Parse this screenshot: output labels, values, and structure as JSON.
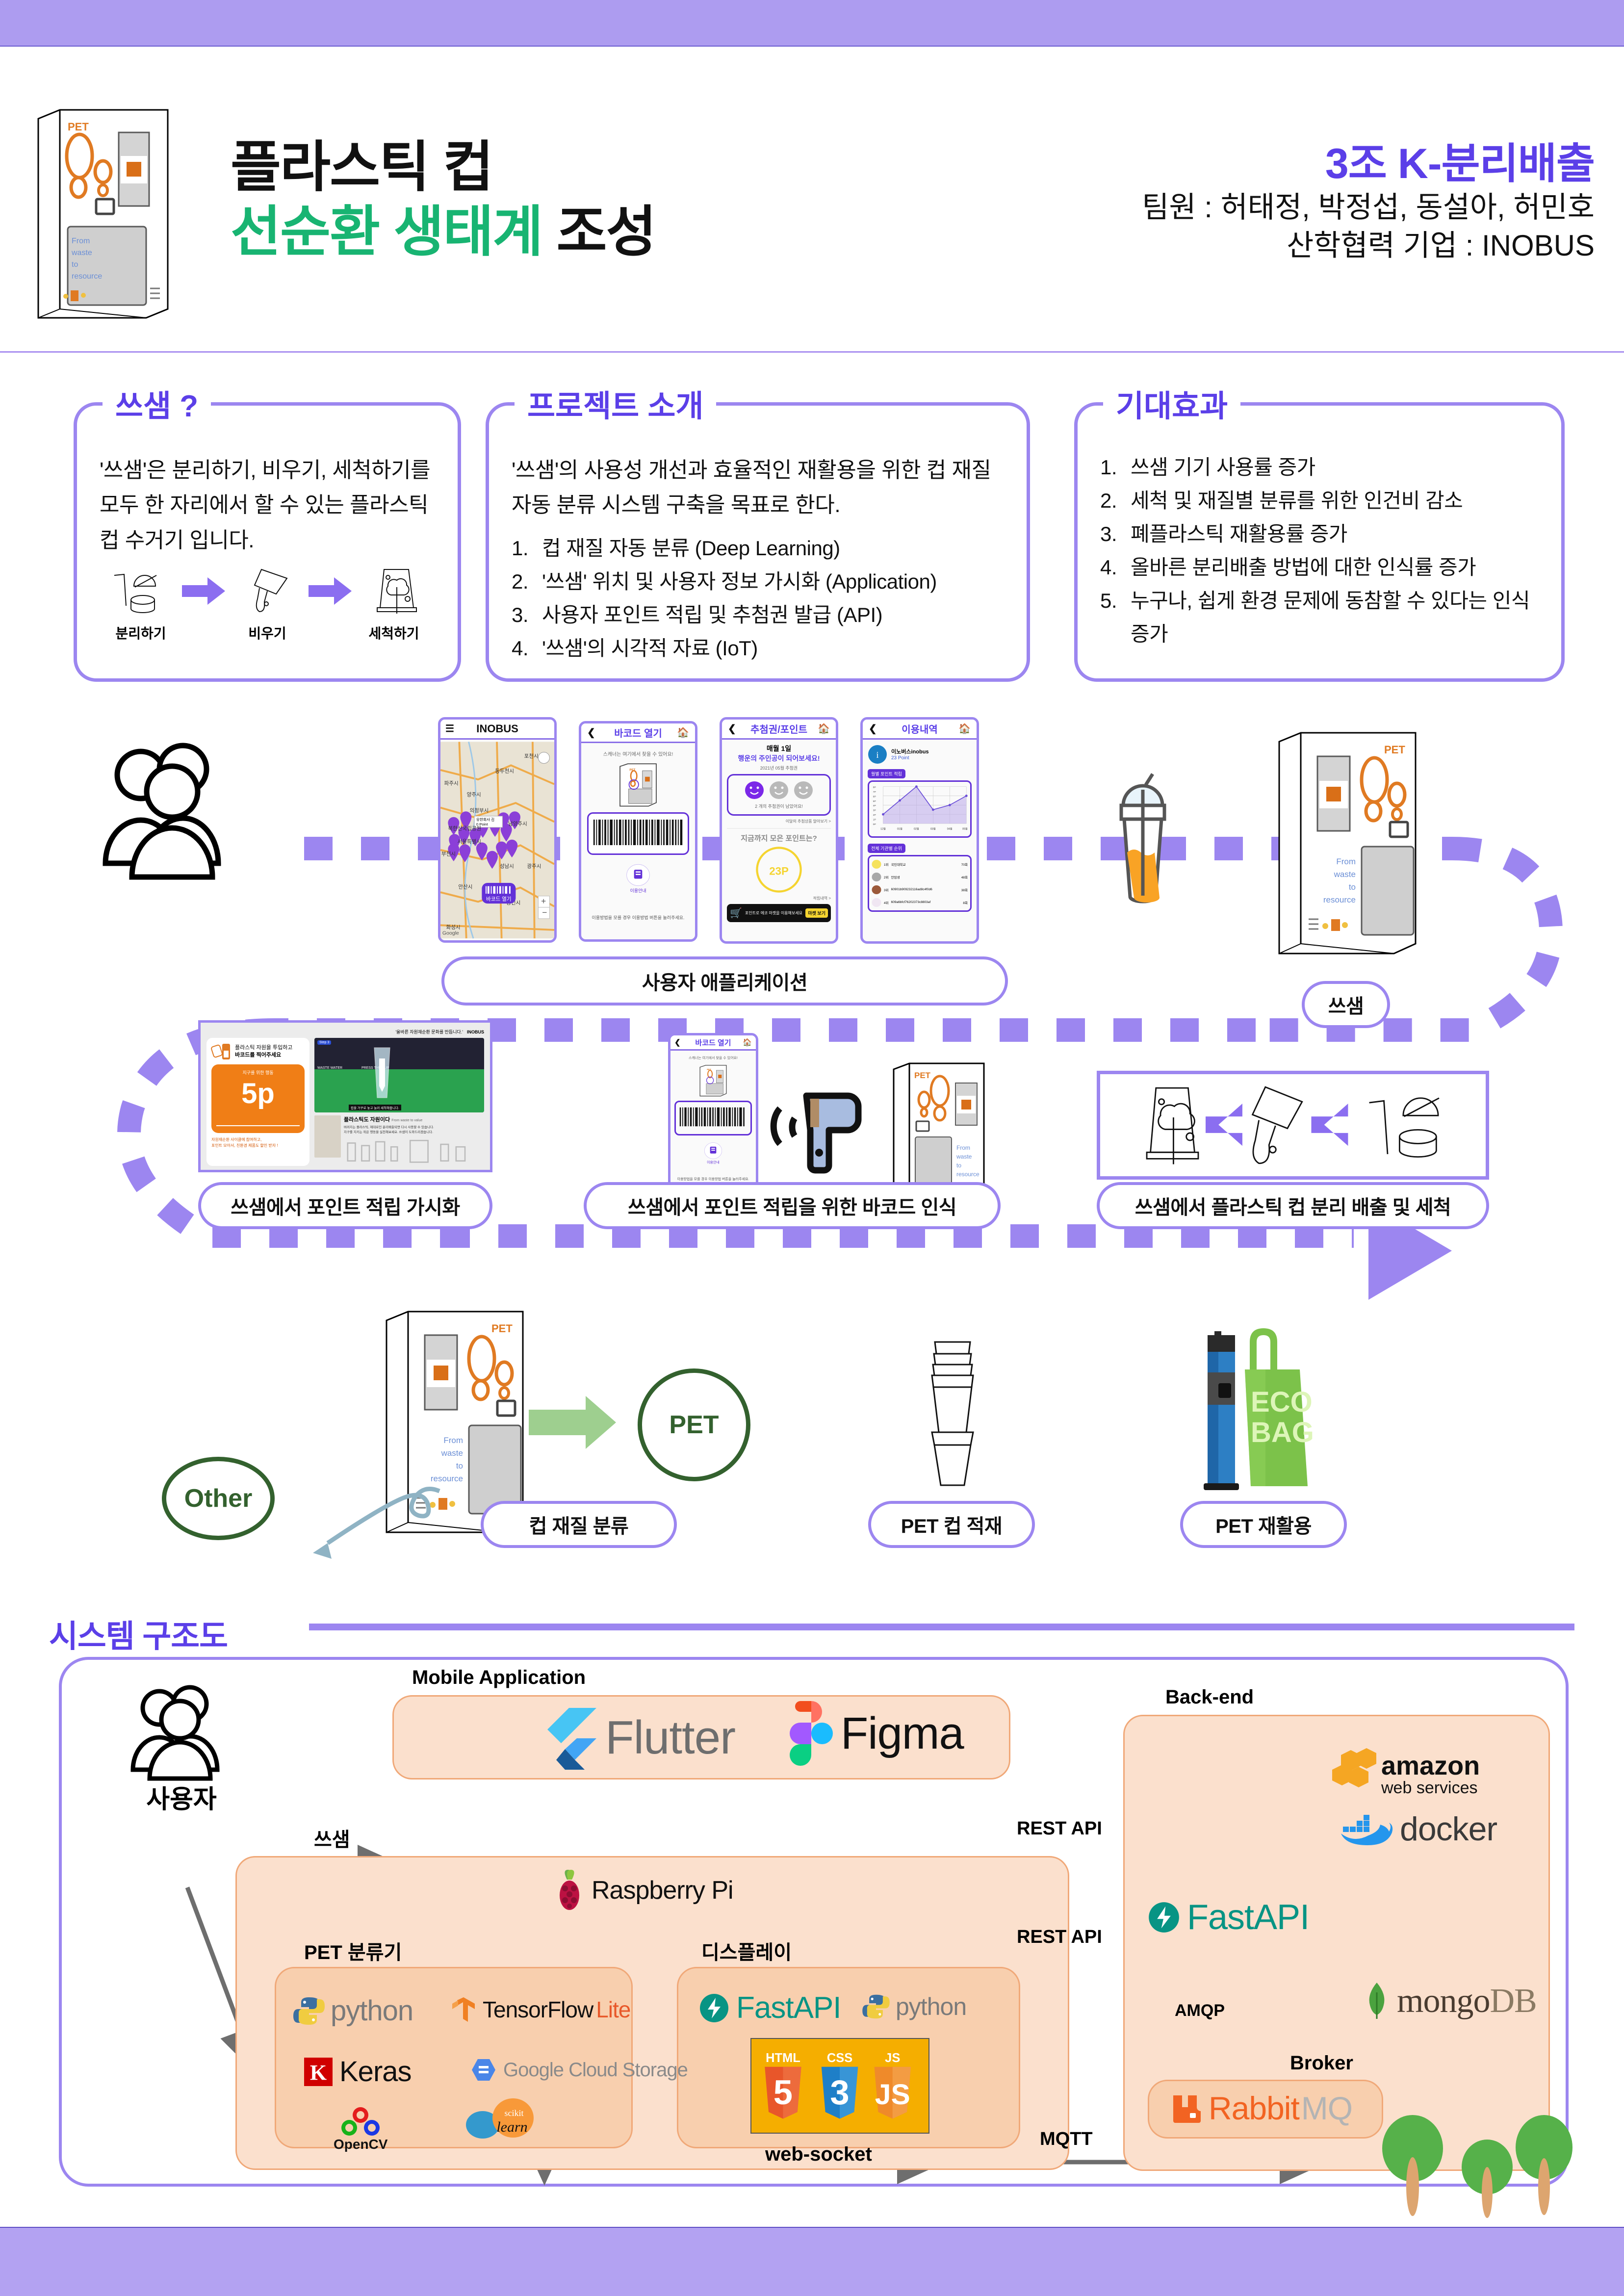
{
  "header": {
    "title_line1": "플라스틱 컵",
    "title_line2_green": "선순환 생태계",
    "title_line2_dark": "조성",
    "team_name": "3조 K-분리배출",
    "team_members": "팀원 : 허태정, 박정섭, 동설아, 허민호",
    "team_partner": "산학협력 기업 : INOBUS",
    "kiosk_pet": "PET",
    "kiosk_slogan": "From waste to resource"
  },
  "cards": {
    "about": {
      "title": "쓰샘 ?",
      "paragraph": "'쓰샘'은 분리하기, 비우기, 세척하기를 모두 한 자리에서 할 수 있는 플라스틱 컵 수거기 입니다.",
      "steps": [
        "분리하기",
        "비우기",
        "세척하기"
      ]
    },
    "intro": {
      "title": "프로젝트 소개",
      "paragraph": "'쓰샘'의 사용성 개선과 효율적인 재활용을 위한 컵 재질 자동 분류 시스템 구축을 목표로 한다.",
      "items": [
        {
          "num": "1.",
          "text": "컵 재질 자동 분류 (Deep Learning)"
        },
        {
          "num": "2.",
          "text": "'쓰샘' 위치 및 사용자 정보 가시화 (Application)"
        },
        {
          "num": "3.",
          "text": "사용자 포인트 적립 및 추첨권 발급 (API)"
        },
        {
          "num": "4.",
          "text": "'쓰샘'의 시각적 자료 (IoT)"
        }
      ]
    },
    "effects": {
      "title": "기대효과",
      "items": [
        {
          "num": "1.",
          "text": "쓰샘 기기 사용률 증가"
        },
        {
          "num": "2.",
          "text": "세척 및 재질별 분류를 위한 인건비 감소"
        },
        {
          "num": "3.",
          "text": "폐플라스틱 재활용률 증가"
        },
        {
          "num": "4.",
          "text": "올바른 분리배출 방법에 대한 인식률 증가"
        },
        {
          "num": "5.",
          "text": "누구나, 쉽게 환경 문제에 동참할 수 있다는 인식 증가"
        }
      ]
    }
  },
  "flow": {
    "app_caption": "사용자 애플리케이션",
    "sseum_caption": "쓰샘",
    "point_visual_caption": "쓰샘에서 포인트 적립 가시화",
    "barcode_caption": "쓰샘에서 포인트 적립을 위한 바코드 인식",
    "separate_caption": "쓰샘에서 플라스틱 컵 분리 배출 및 세척",
    "classify_caption": "컵 재질 분류",
    "stack_caption": "PET 컵 적재",
    "recycle_caption": "PET 재활용",
    "pet_circle": "PET",
    "other_circle": "Other"
  },
  "phones": {
    "map": {
      "title": "INOBUS",
      "menu_icon": "hamburger-icon",
      "cities": [
        "포천시",
        "동두천시",
        "파주시",
        "양주시",
        "의정부시",
        "북한산국립공원",
        "서울특별시",
        "부천시",
        "성남시",
        "광주시",
        "안산시",
        "용인시",
        "화성시"
      ],
      "pin_tooltip_name": "유한회사 김",
      "pin_tooltip_point": "0 Point",
      "button": "바코드 열기",
      "map_credit": "Google"
    },
    "barcode": {
      "title": "바코드 열기",
      "hint": "스캐너는 여기에서 찾을 수 있어요!",
      "guide_label": "이용안내",
      "footer": "이용방법을 모를 경우 이용방법 버튼을 눌러주세요."
    },
    "points": {
      "title": "추첨권/포인트",
      "line1": "매월 1일",
      "line2": "행운의 주인공이 되어보세요!",
      "date": "2021년 05월 추첨권",
      "tickets_left": "2 개의 추첨권이 남았어요!",
      "link": "이달의 추첨상품 알아보기 >",
      "collected_label": "지금까지 모은 포인트는?",
      "points_value": "23P",
      "history_link": "적립내역 >",
      "market_text": "포인트로 에코 마켓을 이용해보세요",
      "market_button": "마켓 보기"
    },
    "history": {
      "title": "이용내역",
      "user_name": "이노버스inobus",
      "user_point": "23 Point",
      "chart_label": "월별 포인트 적립",
      "rank_label": "전체 기관별 순위",
      "ranks": [
        {
          "rank": "1위",
          "name": "국민대학교",
          "count": "70회"
        },
        {
          "rank": "2위",
          "name": "안암생",
          "count": "48회"
        },
        {
          "rank": "3위",
          "name": "60901b909232116ad8c4f0d6",
          "count": "38회"
        },
        {
          "rank": "4위",
          "name": "609a6bfcf76202373c8803af",
          "count": "8회"
        }
      ]
    },
    "kiosk_screen": {
      "brand": "INOBUS",
      "tagline": "'올바른 자원재순환 문화를 만듭니다.'",
      "instruction_1": "플라스틱 자원을 투입하고",
      "instruction_2": "바코드를 찍어주세요",
      "action_label": "지구를 위한 행동",
      "point_value": "5p",
      "promo_1": "자원재순환 사이클에 참여하고,",
      "promo_2": "포인트 모아서, 친환경 제품도 할인 받자 !",
      "photo_step": "Step 3",
      "photo_left": "WASTE WATER",
      "photo_right": "PRESS THE CUP",
      "photo_caption": "컵을 거꾸로 놓고 눌러 세척해줍니다.",
      "article_title": "플라스틱도 자원이다",
      "article_sub": "From waste to value",
      "article_body_1": "버려지는 플라스틱, 제대로인 분리배출되면 다시 사용할 수 있습니다.",
      "article_body_2": "지구를 지키는 작은 행동을 실천해보세요. 쓰샘이 도와드리겠습니다."
    }
  },
  "chart_data": {
    "type": "line",
    "title": "월별 포인트 적립",
    "categories": [
      "12월",
      "01월",
      "02월",
      "03월",
      "04월",
      "05월"
    ],
    "values": [
      2,
      5,
      8,
      3,
      4,
      6
    ],
    "xlabel": "",
    "ylabel": "P",
    "ylim": [
      0,
      8
    ],
    "yticks": [
      "0P",
      "1P",
      "2P",
      "3P",
      "4P",
      "5P",
      "6P",
      "7P",
      "8P"
    ],
    "grid": true,
    "legend": "none",
    "color": "#6b4fd8"
  },
  "system": {
    "title": "시스템 구조도",
    "user_label": "사용자",
    "mobile_label": "Mobile Application",
    "sseum_label": "쓰샘",
    "pet_classifier_label": "PET 분류기",
    "display_label": "디스플레이",
    "backend_label": "Back-end",
    "broker_label": "Broker",
    "edges": {
      "rest_api_top": "REST API",
      "rest_api_bottom": "REST API",
      "amqp": "AMQP",
      "mqtt": "MQTT",
      "websocket": "web-socket"
    },
    "logos": {
      "flutter": "Flutter",
      "figma": "Figma",
      "raspberry": "Raspberry Pi",
      "python": "python",
      "tensorflow_a": "TensorFlow",
      "tensorflow_b": "Lite",
      "keras": "Keras",
      "keras_mark": "K",
      "gcs": "Google Cloud Storage",
      "opencv": "OpenCV",
      "scikit_small": "scikit",
      "scikit": "learn",
      "fastapi": "FastAPI",
      "html": "HTML",
      "css": "CSS",
      "js": "JS",
      "html_n": "5",
      "css_n": "3",
      "js_n": "JS",
      "amazon": "amazon",
      "amazon_sub": "web services",
      "docker": "docker",
      "mongo_a": "mongo",
      "mongo_b": "DB",
      "rabbit_a": "Rabbit",
      "rabbit_b": "MQ"
    }
  }
}
